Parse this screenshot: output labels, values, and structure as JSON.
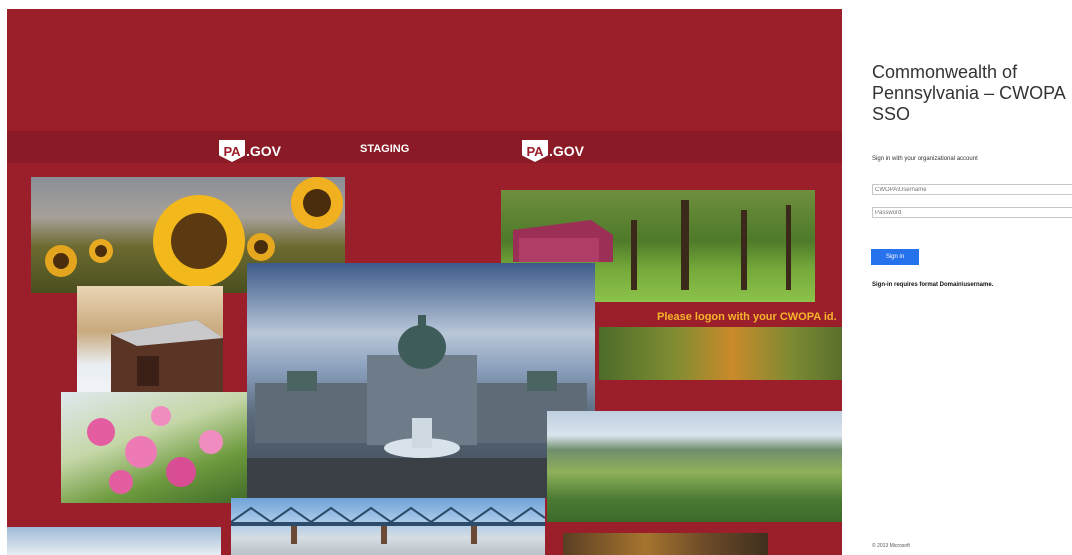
{
  "left": {
    "brand": {
      "key_text": "PA",
      "gov_text": ".GOV"
    },
    "staging": "STAGING",
    "banner": "Please logon with your CWOPA id."
  },
  "signin": {
    "title": "Commonwealth of Pennsylvania – CWOPA SSO",
    "prompt": "Sign in with your organizational account",
    "username_placeholder": "CWOPA\\Username",
    "password_placeholder": "Password",
    "button": "Sign in",
    "note": "Sign-in requires format Domain\\username.",
    "copyright": "© 2013 Microsoft"
  },
  "colors": {
    "brand": "#9b1f2b",
    "banner": "#f6b42b",
    "button": "#2672ec"
  }
}
